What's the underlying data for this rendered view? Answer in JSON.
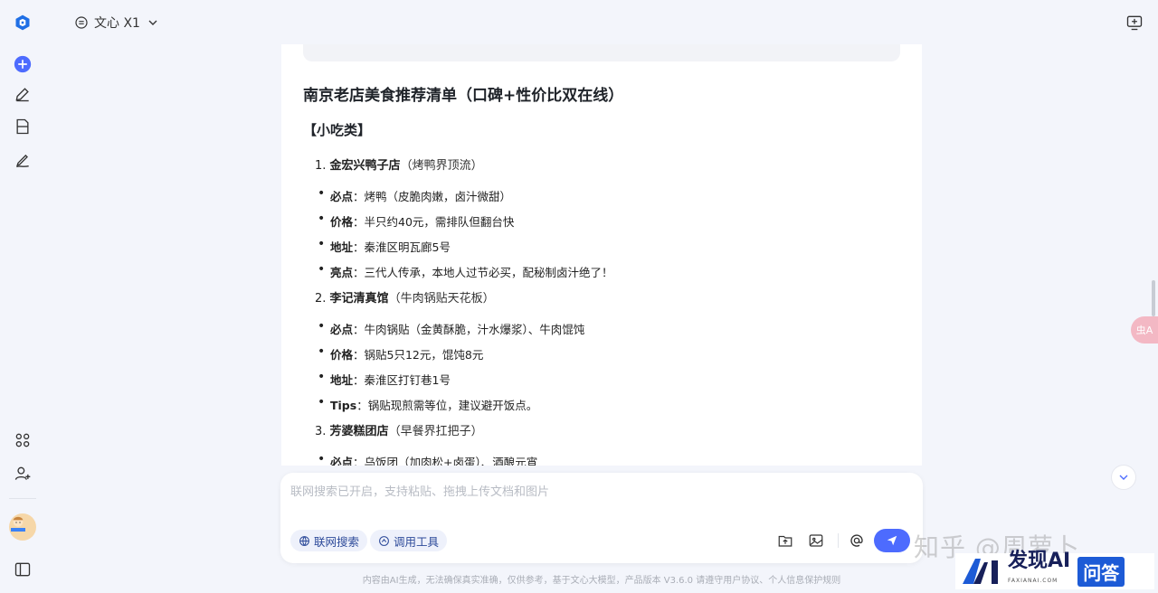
{
  "colors": {
    "accent": "#4d6bfe",
    "brand": "#1f6fe5",
    "chip_text": "#2e4b9a"
  },
  "header": {
    "model_name": "文心 X1"
  },
  "sidebar": {
    "icons": [
      "logo-icon",
      "new-chat-icon",
      "edit-icon",
      "document-icon",
      "pen-sign-icon",
      "apps-icon",
      "add-user-icon",
      "sidebar-toggle-icon"
    ]
  },
  "content": {
    "title": "南京老店美食推荐清单（口碑+性价比双在线）",
    "section": "【小吃类】",
    "shops": [
      {
        "num": "1.",
        "name": "金宏兴鸭子店",
        "note": "（烤鸭界顶流）",
        "bullets": [
          {
            "key": "必点",
            "text": "：烤鸭（皮脆肉嫩，卤汁微甜）"
          },
          {
            "key": "价格",
            "text": "：半只约40元，需排队但翻台快"
          },
          {
            "key": "地址",
            "text": "：秦淮区明瓦廊5号"
          },
          {
            "key": "亮点",
            "text": "：三代人传承，本地人过节必买，配秘制卤汁绝了！"
          }
        ]
      },
      {
        "num": "2.",
        "name": "李记清真馆",
        "note": "（牛肉锅贴天花板）",
        "bullets": [
          {
            "key": "必点",
            "text": "：牛肉锅贴（金黄酥脆，汁水爆浆）、牛肉馄饨"
          },
          {
            "key": "价格",
            "text": "：锅贴5只12元，馄饨8元"
          },
          {
            "key": "地址",
            "text": "：秦淮区打钉巷1号"
          },
          {
            "key": "Tips",
            "text": "：锅贴现煎需等位，建议避开饭点。"
          }
        ]
      },
      {
        "num": "3.",
        "name": "芳婆糕团店",
        "note": "（早餐界扛把子）",
        "bullets": [
          {
            "key": "必点",
            "text": "：乌饭团（加肉松+卤蛋）、酒酿元宵"
          }
        ]
      }
    ]
  },
  "input": {
    "placeholder": "联网搜索已开启，支持粘贴、拖拽上传文档和图片",
    "web_search_label": "联网搜索",
    "tools_label": "调用工具"
  },
  "footer": {
    "text": "内容由AI生成，无法确保真实准确，仅供参考，基于文心大模型，产品版本 V3.6.0 请遵守用户协议、个人信息保护规则"
  },
  "watermark": {
    "text": "知乎 @周萝卜",
    "brand": "发现AI",
    "brand_sub": "FAXIANAI.COM",
    "tag": "问答"
  },
  "floating": {
    "label": "虫A"
  }
}
